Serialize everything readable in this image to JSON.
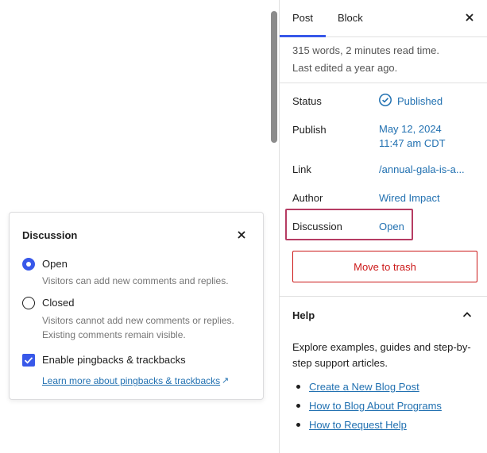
{
  "sidebar": {
    "tabs": [
      {
        "label": "Post",
        "active": true
      },
      {
        "label": "Block",
        "active": false
      }
    ],
    "meta": {
      "words": "315 words, 2 minutes read time.",
      "edited": "Last edited a year ago."
    },
    "rows": {
      "status": {
        "label": "Status",
        "value": "Published"
      },
      "publish": {
        "label": "Publish",
        "value_line1": "May 12, 2024",
        "value_line2": "11:47 am CDT"
      },
      "link": {
        "label": "Link",
        "value": "/annual-gala-is-a..."
      },
      "author": {
        "label": "Author",
        "value": "Wired Impact"
      },
      "discussion": {
        "label": "Discussion",
        "value": "Open"
      }
    },
    "trash_label": "Move to trash",
    "help": {
      "title": "Help",
      "text": "Explore examples, guides and step-by-step support articles.",
      "links": [
        "Create a New Blog Post",
        "How to Blog About Programs",
        "How to Request Help"
      ]
    }
  },
  "popover": {
    "title": "Discussion",
    "options": [
      {
        "label": "Open",
        "help": "Visitors can add new comments and replies.",
        "selected": true
      },
      {
        "label": "Closed",
        "help_line1": "Visitors cannot add new comments or replies.",
        "help_line2": "Existing comments remain visible.",
        "selected": false
      }
    ],
    "pingbacks": {
      "label": "Enable pingbacks & trackbacks",
      "checked": true
    },
    "learn_more": "Learn more about pingbacks & trackbacks",
    "external_glyph": "↗"
  },
  "colors": {
    "accent": "#3858e9",
    "link": "#2271b1",
    "danger": "#cc1818",
    "highlight": "#b63c63"
  },
  "icons": [
    "close-icon",
    "published-check-icon",
    "chevron-up-icon",
    "external-link-icon"
  ]
}
